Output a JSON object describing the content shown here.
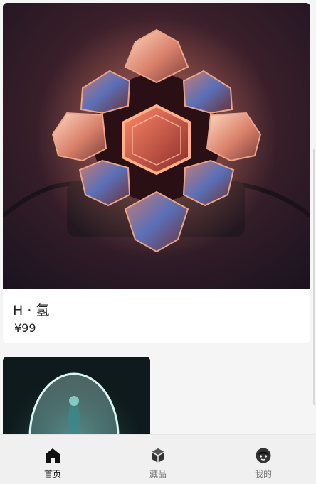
{
  "feed": {
    "items": [
      {
        "title": "H · 氢",
        "price": "¥99",
        "image_icon": "glowing-hexagon-gem-image"
      },
      {
        "image_icon": "glowing-egg-figure-image"
      }
    ]
  },
  "tabbar": {
    "tabs": [
      {
        "label": "首页",
        "icon": "home-icon",
        "active": true
      },
      {
        "label": "藏品",
        "icon": "cube-icon",
        "active": false
      },
      {
        "label": "我的",
        "icon": "face-icon",
        "active": false
      }
    ]
  },
  "colors": {
    "background": "#f5f5f5",
    "card": "#ffffff",
    "tabbar": "#f0f0f0",
    "active_text": "#111111",
    "inactive_text": "#777777",
    "icon": "#333333"
  }
}
